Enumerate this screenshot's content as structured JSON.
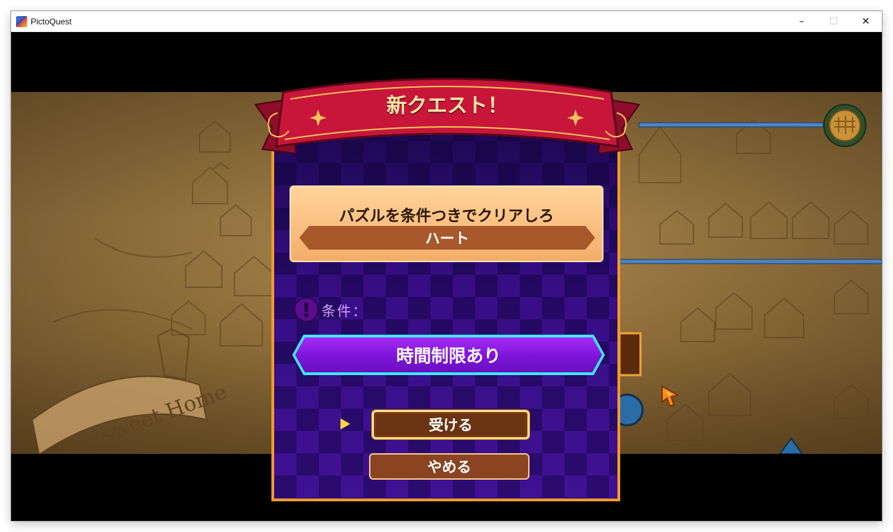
{
  "window": {
    "title": "PictoQuest",
    "icon": "pictoquest-app-icon",
    "controls": {
      "minimize": "–",
      "maximize": "☐",
      "close": "✕"
    }
  },
  "map": {
    "sign_text": "ome sweet Home"
  },
  "dialog": {
    "header": "新クエスト！",
    "quest_description": "パズルを条件つきでクリアしろ",
    "quest_target": "ハート",
    "condition_label": "条件：",
    "condition_value": "時間制限あり",
    "accept_label": "受ける",
    "cancel_label": "やめる",
    "selected_option": "受ける"
  },
  "colors": {
    "ribbon": "#c8163a",
    "ribbon_text": "#ffe7a8",
    "dialog_border": "#f39a2a",
    "condition_bar": "#8a1ce8",
    "condition_glow": "#3fe7ff",
    "button": "#8a4422"
  }
}
